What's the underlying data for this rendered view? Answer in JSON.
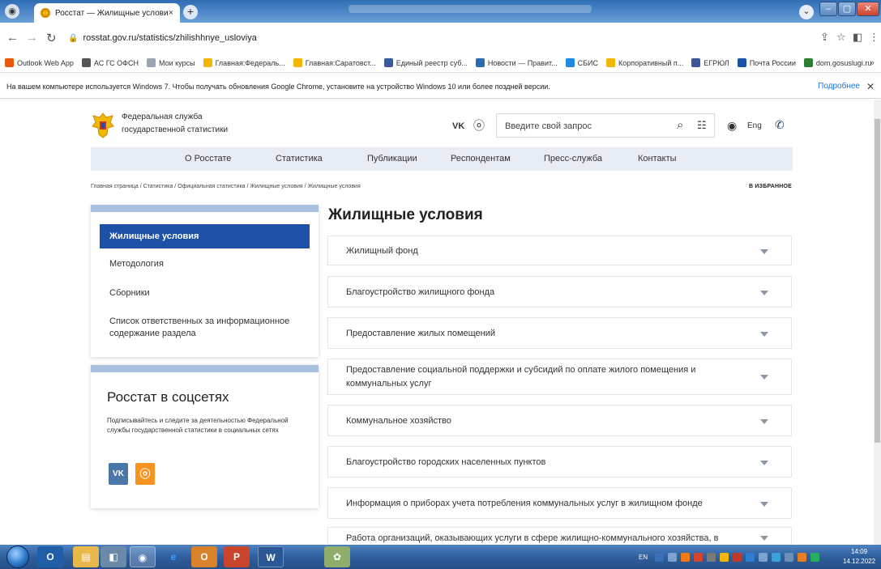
{
  "browser": {
    "tab_title": "Росстат — Жилищные условия",
    "tab_close": "×",
    "new_tab": "+",
    "url": "rosstat.gov.ru/statistics/zhilishhnye_usloviya",
    "bookmarks": [
      {
        "label": "Outlook Web App",
        "color": "#e8590c"
      },
      {
        "label": "АС ГС ОФСН",
        "color": "#555555"
      },
      {
        "label": "Мои курсы",
        "color": "#9aa5b1"
      },
      {
        "label": "Главная:Федераль...",
        "color": "#f2b705"
      },
      {
        "label": "Главная:Саратовст...",
        "color": "#f2b705"
      },
      {
        "label": "Единый реестр суб...",
        "color": "#3b5998"
      },
      {
        "label": "Новости — Правит...",
        "color": "#2b6cb0"
      },
      {
        "label": "СБИС",
        "color": "#1e88e5"
      },
      {
        "label": "Корпоративный п...",
        "color": "#f2b705"
      },
      {
        "label": "ЕГРЮЛ",
        "color": "#3b5998"
      },
      {
        "label": "Почта России",
        "color": "#1a56a6"
      },
      {
        "label": "dom.gosuslugi.ru",
        "color": "#2e7d32"
      }
    ],
    "bookmarks_more": "»",
    "infobar_text": "На вашем компьютере используется Windows 7. Чтобы получать обновления Google Chrome, установите на устройство Windows 10 или более поздней версии.",
    "infobar_more": "Подробнее",
    "infobar_close": "✕"
  },
  "header": {
    "brand_line1": "Федеральная служба",
    "brand_line2": "государственной статистики",
    "vk": "VK",
    "search_placeholder": "Введите свой запрос",
    "lang": "Eng"
  },
  "nav": [
    "О Росстате",
    "Статистика",
    "Публикации",
    "Респондентам",
    "Пресс-служба",
    "Контакты"
  ],
  "breadcrumb": "Главная страница / Статистика / Официальная статистика / Жилищные условия / Жилищные условия",
  "favorite": "В ИЗБРАННОЕ",
  "sidebar": {
    "active": "Жилищные условия",
    "items": [
      "Методология",
      "Сборники",
      "Список ответственных за информационное содержание раздела"
    ]
  },
  "social": {
    "title": "Росстат в соцсетях",
    "text": "Подписывайтесь и следите за деятельностью Федеральной службы государственной статистики в социальных сетях",
    "vk": "VK",
    "ok": "ok"
  },
  "main": {
    "title": "Жилищные условия",
    "sections": [
      "Жилищный фонд",
      "Благоустройство жилищного фонда",
      "Предоставление жилых помещений",
      "Предоставление социальной поддержки и субсидий по оплате жилого помещения и коммунальных услуг",
      "Коммунальное хозяйство",
      "Благоустройство городских населенных пунктов",
      "Информация о приборах учета потребления коммунальных услуг в жилищном фонде",
      "Работа организаций, оказывающих услуги в сфере жилищно-коммунального хозяйства, в"
    ]
  },
  "taskbar": {
    "apps": [
      "",
      "",
      "",
      "",
      "",
      "",
      "",
      ""
    ],
    "lang": "EN",
    "time": "14:09",
    "date": "14.12.2022"
  }
}
